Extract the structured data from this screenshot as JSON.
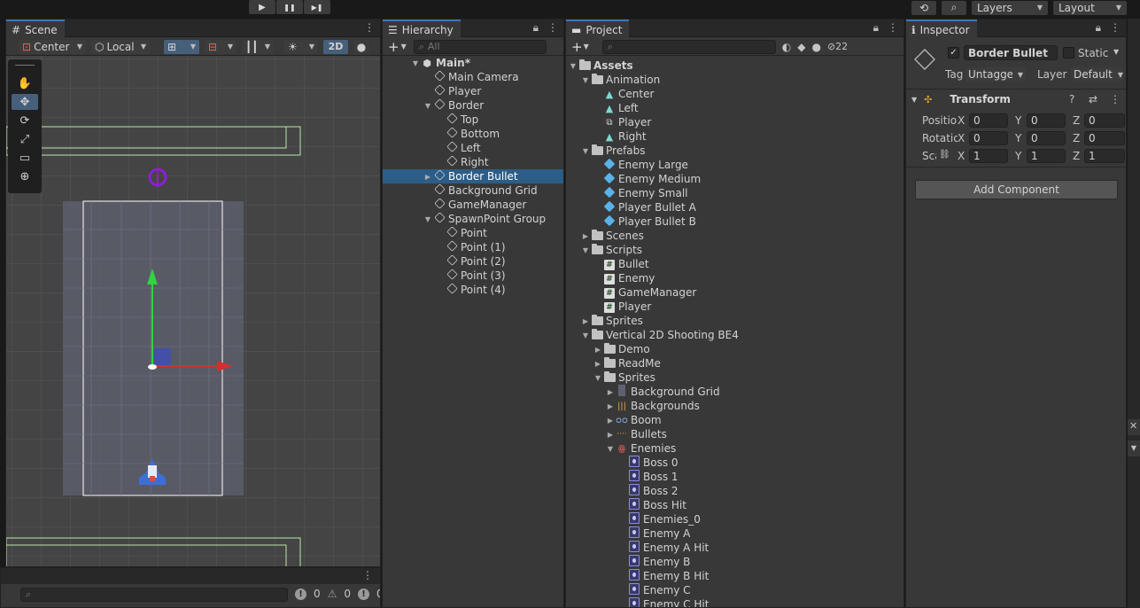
{
  "toolbar": {
    "play_icons": [
      "▶",
      "❚❚",
      "▶❚"
    ],
    "history_icon": "history-icon",
    "search_icon": "search-icon",
    "layers_label": "Layers",
    "layout_label": "Layout"
  },
  "scene": {
    "tab_label": "Scene",
    "pivot_label": "Center",
    "space_label": "Local",
    "mode_2d_label": "2D",
    "tools": [
      "view",
      "move",
      "rotate",
      "scale",
      "rect",
      "transform"
    ],
    "active_tool": "move"
  },
  "console": {
    "error_count": "0",
    "warning_count": "0",
    "info_count": "0"
  },
  "hierarchy": {
    "tab_label": "Hierarchy",
    "search_placeholder": "All",
    "items": [
      {
        "label": "Main*",
        "depth": 0,
        "arrow": "down",
        "icon": "unity",
        "bold": true
      },
      {
        "label": "Main Camera",
        "depth": 1,
        "arrow": "",
        "icon": "cube"
      },
      {
        "label": "Player",
        "depth": 1,
        "arrow": "",
        "icon": "cube"
      },
      {
        "label": "Border",
        "depth": 1,
        "arrow": "down",
        "icon": "cube"
      },
      {
        "label": "Top",
        "depth": 2,
        "arrow": "",
        "icon": "cube"
      },
      {
        "label": "Bottom",
        "depth": 2,
        "arrow": "",
        "icon": "cube"
      },
      {
        "label": "Left",
        "depth": 2,
        "arrow": "",
        "icon": "cube"
      },
      {
        "label": "Right",
        "depth": 2,
        "arrow": "",
        "icon": "cube"
      },
      {
        "label": "Border Bullet",
        "depth": 1,
        "arrow": "right",
        "icon": "cube",
        "selected": true
      },
      {
        "label": "Background Grid",
        "depth": 1,
        "arrow": "",
        "icon": "cube"
      },
      {
        "label": "GameManager",
        "depth": 1,
        "arrow": "",
        "icon": "cube"
      },
      {
        "label": "SpawnPoint Group",
        "depth": 1,
        "arrow": "down",
        "icon": "cube"
      },
      {
        "label": "Point",
        "depth": 2,
        "arrow": "",
        "icon": "cube"
      },
      {
        "label": "Point (1)",
        "depth": 2,
        "arrow": "",
        "icon": "cube"
      },
      {
        "label": "Point (2)",
        "depth": 2,
        "arrow": "",
        "icon": "cube"
      },
      {
        "label": "Point (3)",
        "depth": 2,
        "arrow": "",
        "icon": "cube"
      },
      {
        "label": "Point (4)",
        "depth": 2,
        "arrow": "",
        "icon": "cube"
      }
    ]
  },
  "project": {
    "tab_label": "Project",
    "hidden_count": "22",
    "items": [
      {
        "label": "Assets",
        "depth": 0,
        "arrow": "down",
        "icon": "folder",
        "bold": true
      },
      {
        "label": "Animation",
        "depth": 1,
        "arrow": "down",
        "icon": "folder"
      },
      {
        "label": "Center",
        "depth": 2,
        "arrow": "",
        "icon": "anim"
      },
      {
        "label": "Left",
        "depth": 2,
        "arrow": "",
        "icon": "anim"
      },
      {
        "label": "Player",
        "depth": 2,
        "arrow": "",
        "icon": "animator"
      },
      {
        "label": "Right",
        "depth": 2,
        "arrow": "",
        "icon": "anim"
      },
      {
        "label": "Prefabs",
        "depth": 1,
        "arrow": "down",
        "icon": "folder"
      },
      {
        "label": "Enemy Large",
        "depth": 2,
        "arrow": "",
        "icon": "prefab"
      },
      {
        "label": "Enemy Medium",
        "depth": 2,
        "arrow": "",
        "icon": "prefab"
      },
      {
        "label": "Enemy Small",
        "depth": 2,
        "arrow": "",
        "icon": "prefab"
      },
      {
        "label": "Player Bullet A",
        "depth": 2,
        "arrow": "",
        "icon": "prefab"
      },
      {
        "label": "Player Bullet B",
        "depth": 2,
        "arrow": "",
        "icon": "prefab"
      },
      {
        "label": "Scenes",
        "depth": 1,
        "arrow": "right",
        "icon": "folder"
      },
      {
        "label": "Scripts",
        "depth": 1,
        "arrow": "down",
        "icon": "folder"
      },
      {
        "label": "Bullet",
        "depth": 2,
        "arrow": "",
        "icon": "script"
      },
      {
        "label": "Enemy",
        "depth": 2,
        "arrow": "",
        "icon": "script"
      },
      {
        "label": "GameManager",
        "depth": 2,
        "arrow": "",
        "icon": "script"
      },
      {
        "label": "Player",
        "depth": 2,
        "arrow": "",
        "icon": "script"
      },
      {
        "label": "Sprites",
        "depth": 1,
        "arrow": "right",
        "icon": "folder"
      },
      {
        "label": "Vertical 2D Shooting BE4",
        "depth": 1,
        "arrow": "down",
        "icon": "folder"
      },
      {
        "label": "Demo",
        "depth": 2,
        "arrow": "right",
        "icon": "folder"
      },
      {
        "label": "ReadMe",
        "depth": 2,
        "arrow": "right",
        "icon": "folder"
      },
      {
        "label": "Sprites",
        "depth": 2,
        "arrow": "down",
        "icon": "folder"
      },
      {
        "label": "Background Grid",
        "depth": 3,
        "arrow": "right",
        "icon": "thumb-grid"
      },
      {
        "label": "Backgrounds",
        "depth": 3,
        "arrow": "right",
        "icon": "thumb-bg"
      },
      {
        "label": "Boom",
        "depth": 3,
        "arrow": "right",
        "icon": "thumb-boom"
      },
      {
        "label": "Bullets",
        "depth": 3,
        "arrow": "right",
        "icon": "thumb-bullets"
      },
      {
        "label": "Enemies",
        "depth": 3,
        "arrow": "down",
        "icon": "thumb-enemies"
      },
      {
        "label": "Boss 0",
        "depth": 4,
        "arrow": "",
        "icon": "sprite"
      },
      {
        "label": "Boss 1",
        "depth": 4,
        "arrow": "",
        "icon": "sprite"
      },
      {
        "label": "Boss 2",
        "depth": 4,
        "arrow": "",
        "icon": "sprite"
      },
      {
        "label": "Boss Hit",
        "depth": 4,
        "arrow": "",
        "icon": "sprite"
      },
      {
        "label": "Enemies_0",
        "depth": 4,
        "arrow": "",
        "icon": "sprite"
      },
      {
        "label": "Enemy A",
        "depth": 4,
        "arrow": "",
        "icon": "sprite"
      },
      {
        "label": "Enemy A Hit",
        "depth": 4,
        "arrow": "",
        "icon": "sprite"
      },
      {
        "label": "Enemy B",
        "depth": 4,
        "arrow": "",
        "icon": "sprite"
      },
      {
        "label": "Enemy B Hit",
        "depth": 4,
        "arrow": "",
        "icon": "sprite"
      },
      {
        "label": "Enemy C",
        "depth": 4,
        "arrow": "",
        "icon": "sprite"
      },
      {
        "label": "Enemy C Hit",
        "depth": 4,
        "arrow": "",
        "icon": "sprite"
      }
    ]
  },
  "inspector": {
    "tab_label": "Inspector",
    "object_name": "Border Bullet",
    "active_checked": true,
    "static_label": "Static",
    "tag_label": "Tag",
    "tag_value": "Untagged",
    "layer_label": "Layer",
    "layer_value": "Default",
    "component_title": "Transform",
    "position_label": "Position",
    "rotation_label": "Rotation",
    "scale_label": "Scale",
    "axis_x": "X",
    "axis_y": "Y",
    "axis_z": "Z",
    "position": {
      "x": "0",
      "y": "0",
      "z": "0"
    },
    "rotation": {
      "x": "0",
      "y": "0",
      "z": "0"
    },
    "scale": {
      "x": "1",
      "y": "1",
      "z": "1"
    },
    "add_component_label": "Add Component"
  }
}
